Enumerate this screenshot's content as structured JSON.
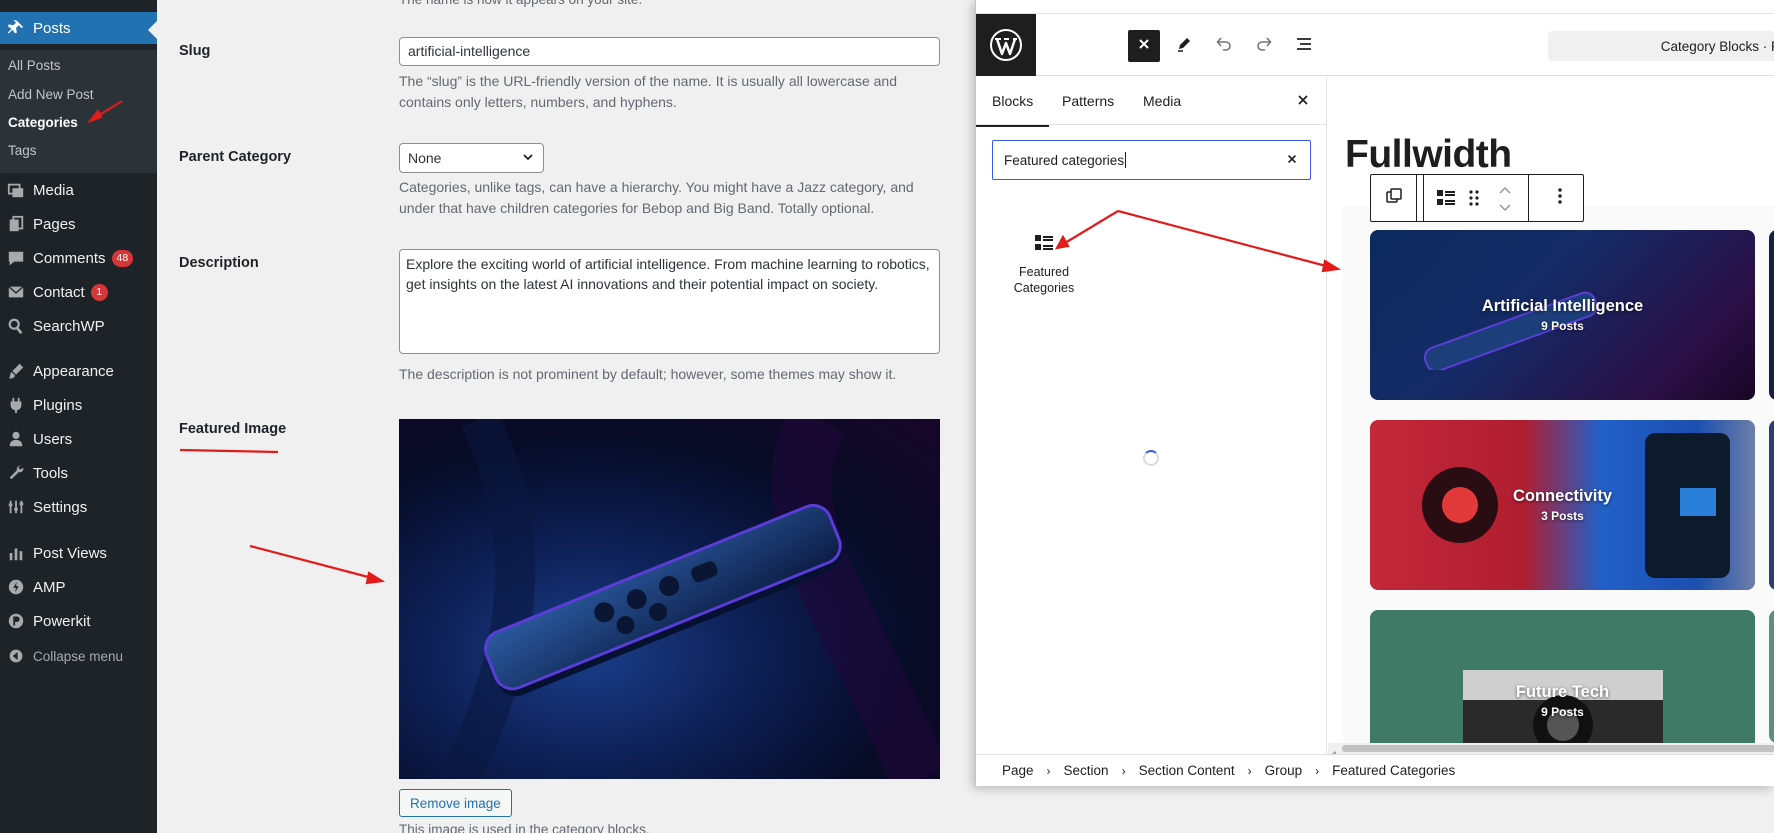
{
  "admin_menu": {
    "posts_label": "Posts",
    "submenu": [
      "All Posts",
      "Add New Post",
      "Categories",
      "Tags"
    ],
    "items": [
      {
        "label": "Media",
        "icon": "media-icon"
      },
      {
        "label": "Pages",
        "icon": "pages-icon"
      },
      {
        "label": "Comments",
        "icon": "comments-icon",
        "badge": "48"
      },
      {
        "label": "Contact",
        "icon": "mail-icon",
        "badge": "1"
      },
      {
        "label": "SearchWP",
        "icon": "searchwp-icon"
      },
      {
        "label": "Appearance",
        "icon": "appearance-icon"
      },
      {
        "label": "Plugins",
        "icon": "plugins-icon"
      },
      {
        "label": "Users",
        "icon": "users-icon"
      },
      {
        "label": "Tools",
        "icon": "tools-icon"
      },
      {
        "label": "Settings",
        "icon": "settings-icon"
      },
      {
        "label": "Post Views",
        "icon": "chart-icon"
      },
      {
        "label": "AMP",
        "icon": "amp-icon"
      },
      {
        "label": "Powerkit",
        "icon": "powerkit-icon"
      }
    ],
    "collapse_label": "Collapse menu"
  },
  "form": {
    "name_help_cut": "The name is how it appears on your site.",
    "slug_label": "Slug",
    "slug_value": "artificial-intelligence",
    "slug_help": "The “slug” is the URL-friendly version of the name. It is usually all lowercase and contains only letters, numbers, and hyphens.",
    "parent_label": "Parent Category",
    "parent_value": "None",
    "parent_help": "Categories, unlike tags, can have a hierarchy. You might have a Jazz category, and under that have children categories for Bebop and Big Band. Totally optional.",
    "description_label": "Description",
    "description_value": "Explore the exciting world of artificial intelligence. From machine learning to robotics, get insights on the latest AI innovations and their potential impact on society.",
    "description_help": "The description is not prominent by default; however, some themes may show it.",
    "featured_label": "Featured Image",
    "remove_button": "Remove image",
    "featured_help_cut": "This image is used in the category blocks."
  },
  "editor": {
    "doc_title": "Category Blocks · P",
    "tabs": [
      "Blocks",
      "Patterns",
      "Media"
    ],
    "search_value": "Featured categories",
    "block_result": "Featured Categories",
    "canvas_heading": "Fullwidth",
    "cards": [
      {
        "title": "Artificial Intelligence",
        "count": "9 Posts"
      },
      {
        "title": "Connectivity",
        "count": "3 Posts"
      },
      {
        "title": "Future Tech",
        "count": "9 Posts"
      }
    ],
    "breadcrumb": [
      "Page",
      "Section",
      "Section Content",
      "Group",
      "Featured Categories"
    ]
  },
  "colors": {
    "accent": "#2271b1",
    "admin_bg": "#1d2327",
    "editor_focus": "#3858e9",
    "annotation": "#e21b1b"
  }
}
